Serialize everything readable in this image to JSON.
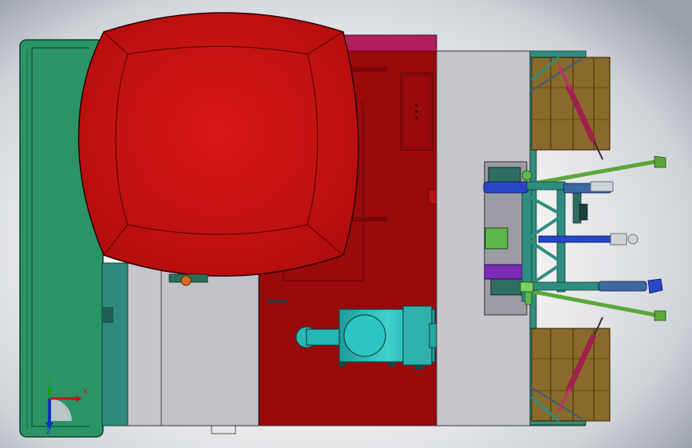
{
  "triad": {
    "x_label": "X",
    "y_label": "Y",
    "z_label": "Z",
    "x_color": "#d01010",
    "y_color": "#10a010",
    "z_color": "#1030c0"
  },
  "colors": {
    "fuel_tank": "#cc1414",
    "hood": "#990a0a",
    "green_frame": "#2a9467",
    "gray_panel": "#c6c6cc",
    "air_filter": "#29b8b5",
    "wood_box": "#8a6a2a",
    "hitch_teal": "#2f8d80",
    "hitch_green": "#5aa83a",
    "purple_block": "#7a2bb8",
    "magenta_strip": "#b0205f",
    "blue_parts": "#2846c8"
  }
}
